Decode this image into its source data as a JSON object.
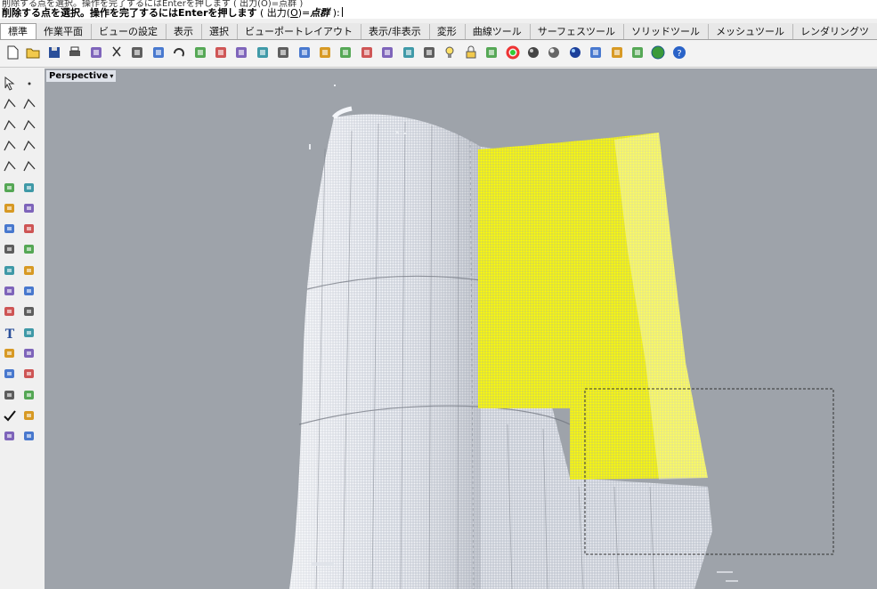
{
  "command": {
    "prompt_previous": "削除する点を選択。操作を完了するにはEnterを押します ( 出力(O)=点群 )",
    "prompt_main": "削除する点を選択。操作を完了するにはEnterを押します",
    "option_prefix": " ( 出力(",
    "option_key": "O",
    "option_suffix": ")=",
    "option_value": "点群",
    "prompt_end": " ):"
  },
  "tabs": [
    {
      "label": "標準",
      "active": true
    },
    {
      "label": "作業平面"
    },
    {
      "label": "ビューの設定"
    },
    {
      "label": "表示"
    },
    {
      "label": "選択"
    },
    {
      "label": "ビューポートレイアウト"
    },
    {
      "label": "表示/非表示"
    },
    {
      "label": "変形"
    },
    {
      "label": "曲線ツール"
    },
    {
      "label": "サーフェスツール"
    },
    {
      "label": "ソリッドツール"
    },
    {
      "label": "メッシュツール"
    },
    {
      "label": "レンダリングツ"
    }
  ],
  "toolbar_icons": [
    "new-file-icon",
    "open-folder-icon",
    "save-icon",
    "print-icon",
    "import-icon",
    "cut-icon",
    "copy-icon",
    "paste-icon",
    "undo-icon",
    "pan-hand-icon",
    "rotate-view-icon",
    "zoom-icon",
    "zoom-window-icon",
    "zoom-extents-icon",
    "zoom-selected-icon",
    "undo-view-icon",
    "four-viewports-icon",
    "named-view-car-icon",
    "camera-icon",
    "target-icon",
    "grid-snap-icon",
    "light-bulb-icon",
    "lock-icon",
    "layer-icon",
    "color-wheel-icon",
    "shaded-sphere-icon",
    "rendered-sphere-icon",
    "render-icon",
    "material-icon",
    "options-gear-icon",
    "dimension-icon",
    "globe-icon",
    "help-icon"
  ],
  "left_tools": [
    "select-arrow-icon",
    "point-icon",
    "polyline-icon",
    "curve-icon",
    "circle-icon",
    "ellipse-icon",
    "polygon-icon",
    "rectangle-icon",
    "arc-icon",
    "fillet-curve-icon",
    "extrude-surface-icon",
    "revolve-surface-icon",
    "box-solid-icon",
    "sphere-solid-icon",
    "cylinder-solid-icon",
    "boolean-icon",
    "mesh-icon",
    "surface-edit-icon",
    "trim-icon",
    "split-icon",
    "group-icon",
    "ungroup-icon",
    "move-icon",
    "copy-move-icon",
    "text-icon",
    "scale-icon",
    "array-icon",
    "blocks-icon",
    "analyze-icon",
    "dimension-tool-icon",
    "grid-icon",
    "gumball-icon",
    "check-icon",
    "render-tool-icon",
    "shade-icon",
    "paint-icon"
  ],
  "viewport": {
    "title": "Perspective",
    "menu_arrow": "▾",
    "colors": {
      "background": "#9ea3aa",
      "point_cloud": "#eef0f4",
      "selected_points": "#ffff00",
      "selection_window": "#333333"
    }
  }
}
